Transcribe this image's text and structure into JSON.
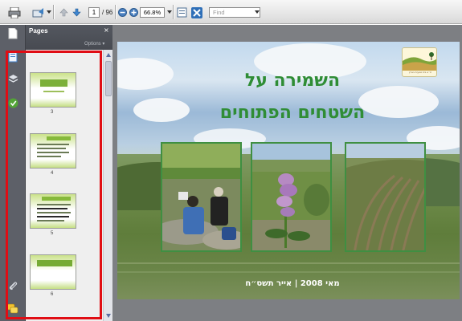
{
  "toolbar": {
    "page_current": "1",
    "page_total": "/ 96",
    "zoom": "66.8%",
    "find_placeholder": "Find"
  },
  "panel": {
    "title": "Pages",
    "close": "×",
    "options": "Options ▾"
  },
  "thumbnails": [
    {
      "number": "3"
    },
    {
      "number": "4"
    },
    {
      "number": "5"
    },
    {
      "number": "6"
    }
  ],
  "slide": {
    "title_line1": "השמירה על",
    "title_line2": "השטחים הפתוחים",
    "footer": "מאי 2008 | אייר תשס״ח",
    "logo_text": "ת״א בית טבעית בארץ"
  },
  "colors": {
    "slide_title": "#2f8d35",
    "highlight": "#e00d14",
    "rail": "#5d6068"
  }
}
